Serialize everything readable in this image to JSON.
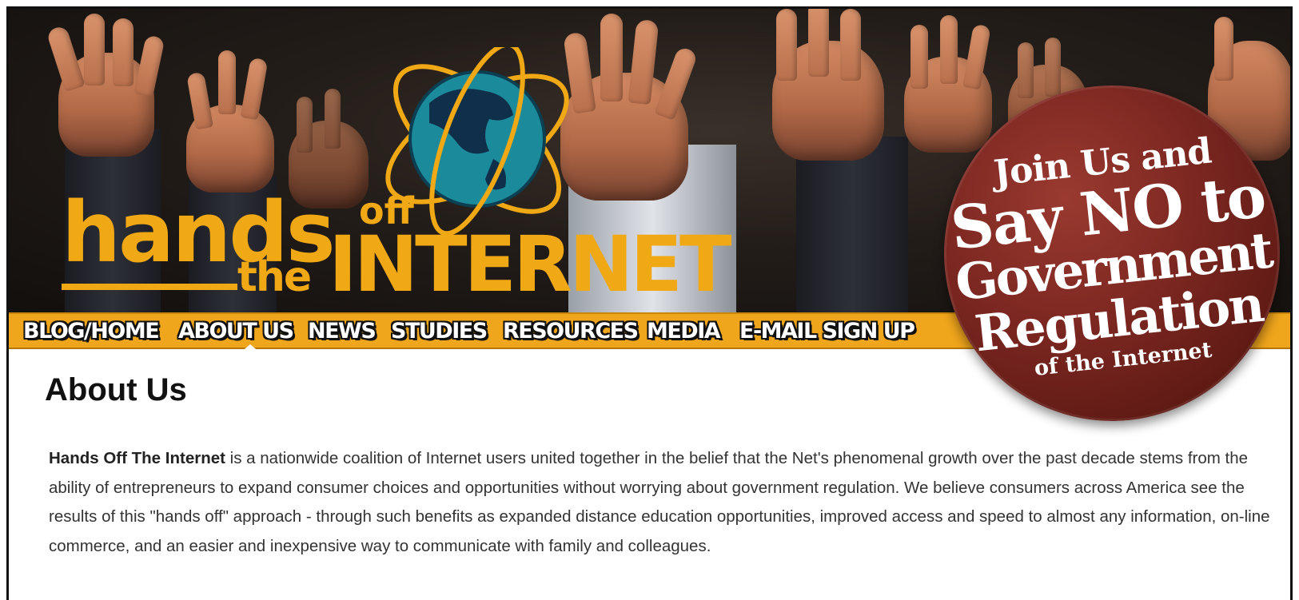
{
  "logo": {
    "hands": "hands",
    "off": "off",
    "the": "the",
    "internet": "INTERNET"
  },
  "nav": {
    "items": [
      {
        "label": "BLOG/HOME"
      },
      {
        "label": "ABOUT US",
        "active": true
      },
      {
        "label": "NEWS"
      },
      {
        "label": "STUDIES"
      },
      {
        "label": "RESOURCES"
      },
      {
        "label": "MEDIA"
      },
      {
        "label": "E-MAIL SIGN UP"
      }
    ]
  },
  "badge": {
    "line1": "Join Us and",
    "line2": "Say NO to",
    "line3": "Government",
    "line4": "Regulation",
    "line5": "of the Internet"
  },
  "main": {
    "title": "About Us",
    "intro_bold": "Hands Off The Internet",
    "intro_rest": " is a nationwide coalition of Internet users united together in the belief that the Net's phenomenal growth over the past decade stems from the ability of entrepreneurs to expand consumer choices and opportunities without worrying about government regulation. We believe consumers across America see the results of this \"hands off\" approach - through such benefits as expanded distance education opportunities, improved access and speed to almost any information, on-line commerce, and an easier and inexpensive way to communicate with family and colleagues."
  },
  "colors": {
    "brand_gold": "#f0a814",
    "nav_bg": "#efa51c",
    "badge_red": "#7a2620"
  }
}
